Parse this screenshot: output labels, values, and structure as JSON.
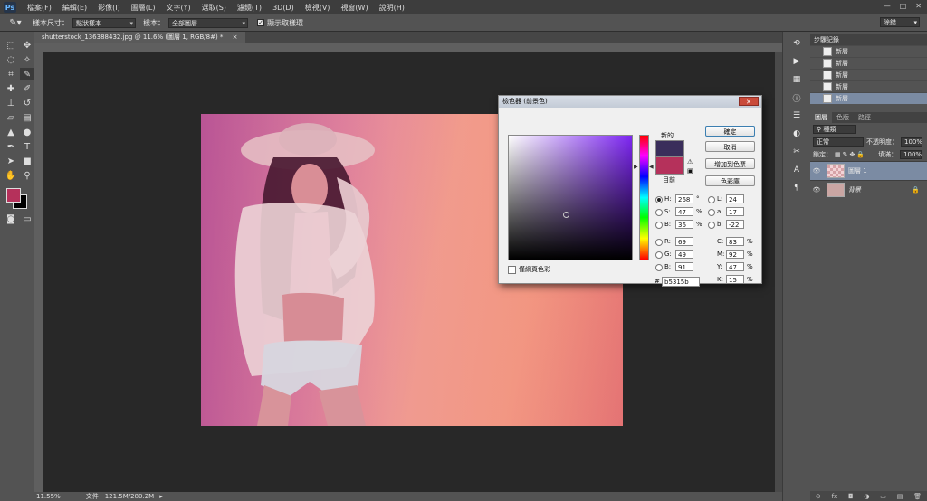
{
  "app": {
    "logo": "Ps",
    "workspace": "除錯"
  },
  "menu": [
    "檔案(F)",
    "編輯(E)",
    "影像(I)",
    "圖層(L)",
    "文字(Y)",
    "選取(S)",
    "濾鏡(T)",
    "3D(D)",
    "檢視(V)",
    "視窗(W)",
    "說明(H)"
  ],
  "window_controls": {
    "min": "—",
    "max": "□",
    "close": "✕"
  },
  "options": {
    "sample_size_label": "樣本尺寸：",
    "sample_size_value": "點狀樣本",
    "sample_label": "樣本：",
    "sample_value": "全部圖層",
    "show_ring_label": "顯示取樣環"
  },
  "document": {
    "tab_title": "shutterstock_136388432.jpg @ 11.6% (圖層 1, RGB/8#) *",
    "tab_close": "×"
  },
  "status": {
    "zoom": "11.55%",
    "doc_info": "文件：121.5M/280.2M"
  },
  "colors": {
    "foreground": "#b5315b",
    "background": "#000000",
    "new_color": "#3a2e5b",
    "current_color": "#b5315b"
  },
  "tools": [
    "marquee-icon",
    "move-icon",
    "lasso-icon",
    "magic-wand-icon",
    "crop-icon",
    "eyedropper-icon",
    "healing-icon",
    "brush-icon",
    "stamp-icon",
    "history-brush-icon",
    "eraser-icon",
    "gradient-icon",
    "blur-icon",
    "dodge-icon",
    "pen-icon",
    "type-icon",
    "path-select-icon",
    "shape-icon",
    "hand-icon",
    "zoom-icon"
  ],
  "history_panel": {
    "title": "步驟記錄",
    "items": [
      "新層",
      "新層",
      "新層",
      "新層",
      "新層"
    ]
  },
  "layers_panel": {
    "tabs": [
      "圖層",
      "色版",
      "路徑"
    ],
    "filter": "種類",
    "blend_mode": "正常",
    "opacity_label": "不透明度：",
    "opacity_value": "100%",
    "lock_label": "鎖定：",
    "fill_label": "填滿：",
    "fill_value": "100%",
    "layers": [
      {
        "name": "圖層 1",
        "active": true
      },
      {
        "name": "背景",
        "active": false
      }
    ]
  },
  "color_picker": {
    "title": "檢色器 (前景色)",
    "close": "✕",
    "new_label": "新的",
    "current_label": "目前",
    "buttons": {
      "ok": "確定",
      "cancel": "取消",
      "add_swatch": "增加到色票",
      "libraries": "色彩庫"
    },
    "only_web_label": "僅網頁色彩",
    "H": {
      "label": "H:",
      "value": "268",
      "unit": "°"
    },
    "S": {
      "label": "S:",
      "value": "47",
      "unit": "%"
    },
    "B": {
      "label": "B:",
      "value": "36",
      "unit": "%"
    },
    "R": {
      "label": "R:",
      "value": "69"
    },
    "G": {
      "label": "G:",
      "value": "49"
    },
    "Bl": {
      "label": "B:",
      "value": "91"
    },
    "L": {
      "label": "L:",
      "value": "24"
    },
    "a": {
      "label": "a:",
      "value": "17"
    },
    "b": {
      "label": "b:",
      "value": "-22"
    },
    "C": {
      "label": "C:",
      "value": "83",
      "unit": "%"
    },
    "M": {
      "label": "M:",
      "value": "92",
      "unit": "%"
    },
    "Y": {
      "label": "Y:",
      "value": "47",
      "unit": "%"
    },
    "K": {
      "label": "K:",
      "value": "15",
      "unit": "%"
    },
    "hex_label": "#",
    "hex": "b5315b"
  }
}
